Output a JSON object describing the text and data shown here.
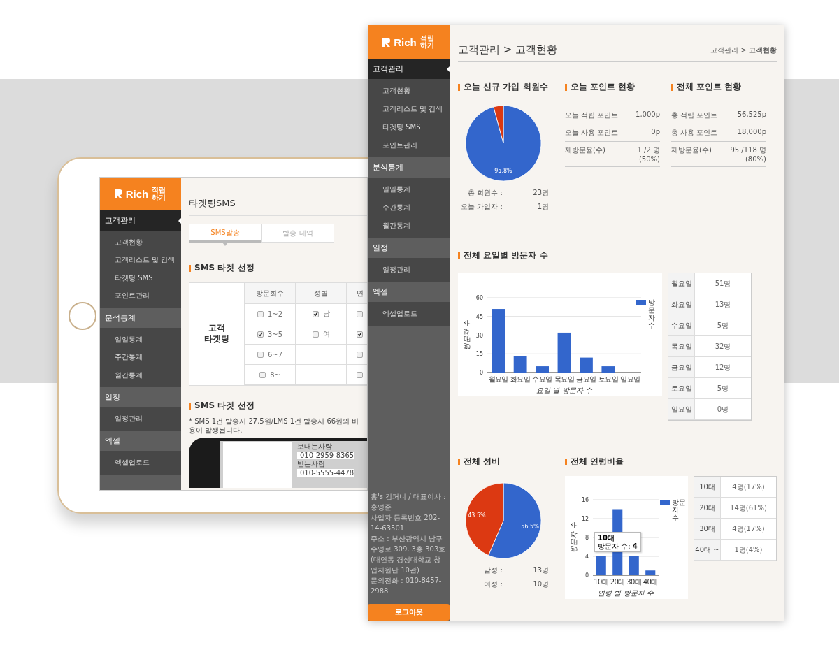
{
  "tablet": {
    "sidebar": {
      "logo": {
        "name": "Rich",
        "tag": "적립 하기"
      },
      "groups": [
        {
          "label": "고객관리",
          "selected": true,
          "items": [
            "고객현황",
            "고객리스트 및 검색",
            "타겟팅 SMS",
            "포인트관리"
          ]
        },
        {
          "label": "분석통계",
          "selected": false,
          "items": [
            "일일통계",
            "주간통계",
            "월간통계"
          ]
        },
        {
          "label": "일정",
          "selected": false,
          "items": [
            "일정관리"
          ]
        },
        {
          "label": "엑셀",
          "selected": false,
          "items": [
            "엑셀업로드"
          ]
        }
      ]
    },
    "page_title": "타겟팅SMS",
    "tabs": [
      {
        "label": "SMS발송",
        "selected": true
      },
      {
        "label": "발송 내역",
        "selected": false
      }
    ],
    "section_title": "SMS 타겟 선정",
    "targeting": {
      "row_header": "고객 타겟팅",
      "columns": [
        "방문회수",
        "성별",
        "연"
      ],
      "rows": [
        [
          {
            "label": "1~2",
            "checked": false
          },
          {
            "label": "남",
            "checked": true
          },
          {
            "checked": false
          }
        ],
        [
          {
            "label": "3~5",
            "checked": true
          },
          {
            "label": "여",
            "checked": false
          },
          {
            "checked": true
          }
        ],
        [
          {
            "label": "6~7",
            "checked": false
          },
          null,
          {
            "checked": false
          }
        ],
        [
          {
            "label": "8~",
            "checked": false
          },
          null,
          {
            "checked": false
          }
        ]
      ]
    },
    "section_title_2": "SMS 타겟 선정",
    "notice": "* SMS 1건 발송시 27,5원/LMS 1건 발송시 66원의 비용이 발생됩니다.",
    "phone": {
      "sender_label": "보내는사람",
      "sender": "010-2959-8365",
      "receiver_label": "받는사람",
      "receiver": "010-5555-4478"
    }
  },
  "main": {
    "sidebar": {
      "logo": {
        "name": "Rich",
        "tag": "적립 하기"
      },
      "groups": [
        {
          "label": "고객관리",
          "selected": true,
          "items": [
            "고객현황",
            "고객리스트 및 검색",
            "타겟팅 SMS",
            "포인트관리"
          ]
        },
        {
          "label": "분석통계",
          "selected": false,
          "items": [
            "일일통계",
            "주간통계",
            "월간통계"
          ]
        },
        {
          "label": "일정",
          "selected": false,
          "items": [
            "일정관리"
          ]
        },
        {
          "label": "엑셀",
          "selected": false,
          "items": [
            "엑셀업로드"
          ]
        }
      ],
      "footer": [
        "홍's 컴퍼니 / 대표이사 : 홍영준",
        "사업자 등록번호 202-14-63501",
        "주소 : 부산광역시 남구 수영로 309, 3층 303호(대연동 경성대학교 창업지원단 10관)",
        "문의전화 : 010-8457-2988"
      ],
      "logout": "로그아웃"
    },
    "title": "고객관리 > 고객현황",
    "breadcrumb": "고객관리 > **고객현황**",
    "new_members": {
      "title": "오늘 신규 가입 회원수",
      "chart_data": {
        "type": "pie",
        "values": [
          95.8,
          4.2
        ],
        "value_labels": [
          "95.8%",
          null
        ]
      },
      "stats": [
        {
          "label": "총 회원수 :",
          "value": "23명"
        },
        {
          "label": "오늘 가입자 :",
          "value": "1명"
        }
      ]
    },
    "today_points": {
      "title": "오늘 포인트 현황",
      "rows": [
        {
          "label": "오늘 적립 포인트",
          "value": "1,000p"
        },
        {
          "label": "오늘 사용 포인트",
          "value": "0p"
        },
        {
          "label": "재방문율(수)",
          "value": "1 /2 명",
          "note": "(50%)"
        }
      ]
    },
    "total_points": {
      "title": "전체 포인트 현황",
      "rows": [
        {
          "label": "총 적립 포인트",
          "value": "56,525p"
        },
        {
          "label": "총 사용 포인트",
          "value": "18,000p"
        },
        {
          "label": "재방문율(수)",
          "value": "95 /118 명",
          "note": "(80%)"
        }
      ]
    },
    "weekday_visitors": {
      "title": "전체 요일별 방문자 수",
      "chart_data": {
        "type": "bar",
        "xlabel": "요일 별 방문자 수",
        "ylabel": "방문자 수",
        "categories": [
          "월요일",
          "화요일",
          "수요일",
          "목요일",
          "금요일",
          "토요일",
          "일요일"
        ],
        "series": [
          {
            "name": "방문자 수",
            "color": "#3366cc",
            "values": [
              51,
              13,
              5,
              32,
              12,
              5,
              0
            ]
          }
        ],
        "ylim": [
          0,
          60
        ],
        "yticks": [
          0,
          15,
          30,
          45,
          60
        ],
        "grid": true
      },
      "table": [
        {
          "label": "월요일",
          "value": "51명"
        },
        {
          "label": "화요일",
          "value": "13명"
        },
        {
          "label": "수요일",
          "value": "5명"
        },
        {
          "label": "목요일",
          "value": "32명"
        },
        {
          "label": "금요일",
          "value": "12명"
        },
        {
          "label": "토요일",
          "value": "5명"
        },
        {
          "label": "일요일",
          "value": "0명"
        }
      ]
    },
    "gender": {
      "title": "전체 성비",
      "chart_data": {
        "type": "pie",
        "values": [
          56.5,
          43.5
        ],
        "value_labels": [
          "56.5%",
          "43.5%"
        ]
      },
      "stats": [
        {
          "label": "남성 :",
          "value": "13명"
        },
        {
          "label": "여성 :",
          "value": "10명"
        }
      ]
    },
    "age": {
      "title": "전체 연령비율",
      "chart_data": {
        "type": "bar",
        "xlabel": "연령 별 방문자 수",
        "ylabel": "방문자 수",
        "categories": [
          "10대",
          "20대",
          "30대",
          "40대"
        ],
        "series": [
          {
            "name": "방문자 수",
            "color": "#3366cc",
            "values": [
              4,
              14,
              4,
              1
            ]
          }
        ],
        "ylim": [
          0,
          16
        ],
        "yticks": [
          0,
          4,
          8,
          12,
          16
        ],
        "grid": true
      },
      "tooltip": {
        "title": "10대",
        "text": "방문자 수: **4**"
      },
      "table": [
        {
          "label": "10대",
          "value": "4명(17%)"
        },
        {
          "label": "20대",
          "value": "14명(61%)"
        },
        {
          "label": "30대",
          "value": "4명(17%)"
        },
        {
          "label": "40대 ~",
          "value": "1명(4%)"
        }
      ]
    }
  }
}
